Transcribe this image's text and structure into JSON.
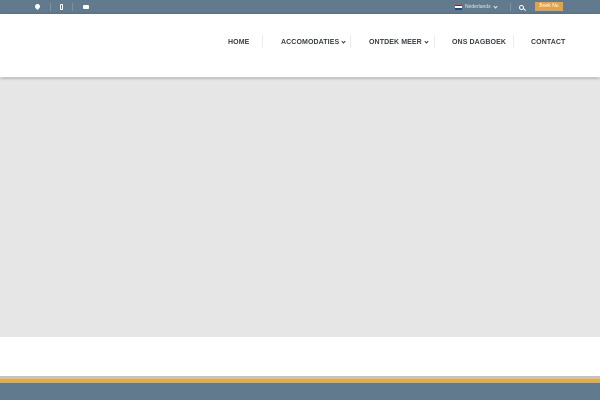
{
  "topbar": {
    "icons": [
      "map-pin-icon",
      "phone-icon",
      "envelope-icon"
    ],
    "language": {
      "label": "Nederlands",
      "flag_colors": [
        "#ae1c28",
        "#ffffff",
        "#21468b"
      ]
    },
    "search_icon": "search-icon",
    "book_label": "Boek Nu"
  },
  "nav": {
    "home": "HOME",
    "accommodations": "ACCOMODATIES",
    "discover": "ONTDEK MEER",
    "diary": "ONS DAGBOEK",
    "contact": "CONTACT"
  },
  "colors": {
    "topbar": "#617a8d",
    "accent": "#e0a24a",
    "hero_placeholder": "#e6e6e6",
    "stripe_orange": "#e9ab3c",
    "footer": "#617a8d"
  }
}
